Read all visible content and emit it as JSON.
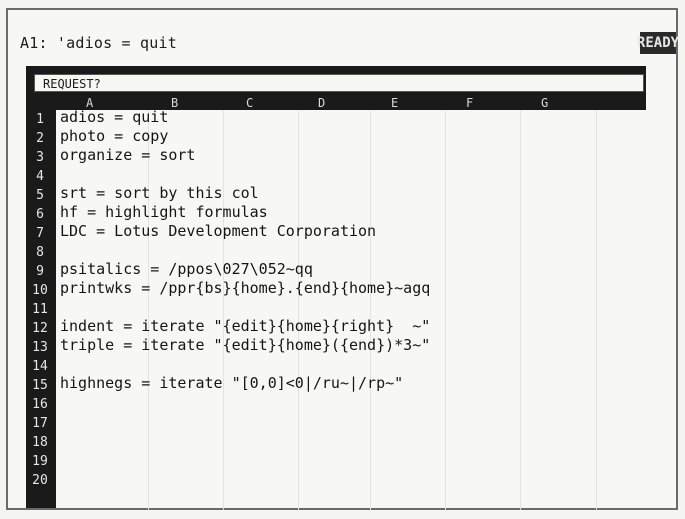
{
  "status_line": "A1: 'adios = quit",
  "mode_indicator": "READY",
  "prompt": "REQUEST?",
  "columns": [
    "A",
    "B",
    "C",
    "D",
    "E",
    "F",
    "G"
  ],
  "rows": [
    "1",
    "2",
    "3",
    "4",
    "5",
    "6",
    "7",
    "8",
    "9",
    "10",
    "11",
    "12",
    "13",
    "14",
    "15",
    "16",
    "17",
    "18",
    "19",
    "20"
  ],
  "cells": [
    "adios = quit",
    "photo = copy",
    "organize = sort",
    "",
    "srt = sort by this col",
    "hf = highlight formulas",
    "LDC = Lotus Development Corporation",
    "",
    "psitalics = /ppos\\027\\052~qq",
    "printwks = /ppr{bs}{home}.{end}{home}~agq",
    "",
    "indent = iterate \"{edit}{home}{right}  ~\"",
    "triple = iterate \"{edit}{home}({end})*3~\"",
    "",
    "highnegs = iterate \"[0,0]<0|/ru~|/rp~\""
  ]
}
